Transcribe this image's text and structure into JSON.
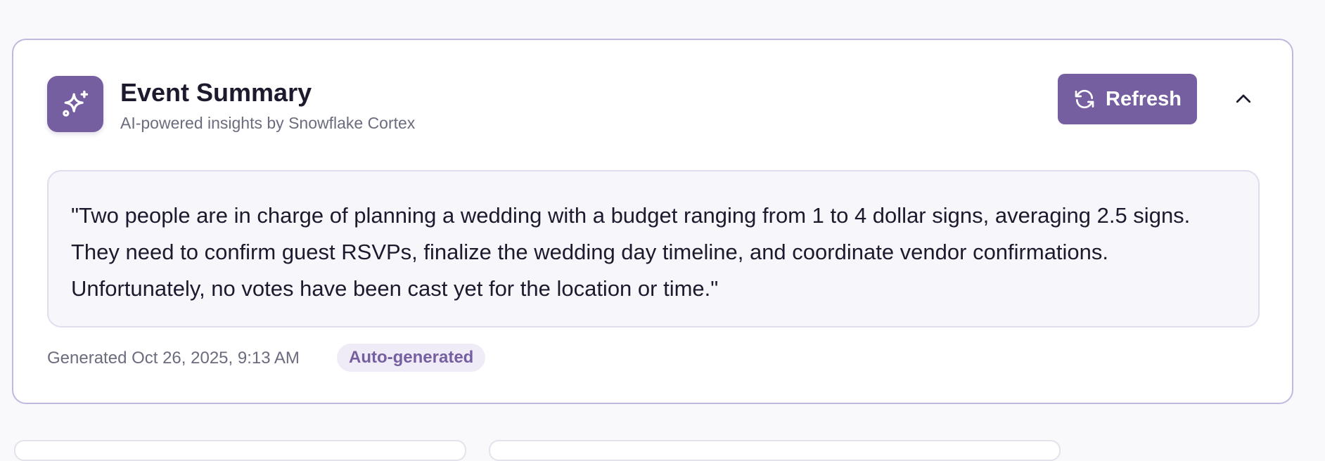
{
  "summary_card": {
    "icon": "sparkles-icon",
    "title": "Event Summary",
    "subtitle": "AI-powered insights by Snowflake Cortex",
    "refresh_icon": "refresh-icon",
    "refresh_label": "Refresh",
    "collapse_icon": "chevron-up-icon",
    "summary_text": "\"Two people are in charge of planning a wedding with a budget ranging from 1 to 4 dollar signs, averaging 2.5 signs. They need to confirm guest RSVPs, finalize the wedding day timeline, and coordinate vendor confirmations. Unfortunately, no votes have been cast yet for the location or time.\"",
    "generated": "Generated Oct 26, 2025, 9:13 AM",
    "badge": "Auto-generated"
  },
  "colors": {
    "accent": "#765fa0",
    "card_border": "#c1b8e0",
    "summary_background": "#f7f6fb",
    "badge_background": "#f0ecf7",
    "text_primary": "#1d1a2e",
    "text_secondary": "#6b6c7e"
  }
}
